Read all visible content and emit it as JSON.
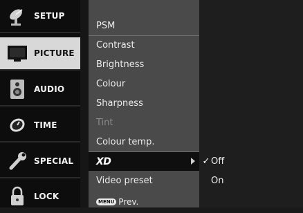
{
  "left_menu": {
    "items": [
      {
        "label": "SETUP",
        "icon": "satellite-dish-icon"
      },
      {
        "label": "PICTURE",
        "icon": "tv-screen-icon"
      },
      {
        "label": "AUDIO",
        "icon": "speaker-icon"
      },
      {
        "label": "TIME",
        "icon": "clock-icon"
      },
      {
        "label": "SPECIAL",
        "icon": "wrench-icon"
      },
      {
        "label": "LOCK",
        "icon": "padlock-icon"
      }
    ],
    "selected": "PICTURE"
  },
  "picture_menu": {
    "items": [
      {
        "label": "PSM"
      },
      {
        "label": "Contrast"
      },
      {
        "label": "Brightness"
      },
      {
        "label": "Colour"
      },
      {
        "label": "Sharpness"
      },
      {
        "label": "Tint",
        "disabled": true
      },
      {
        "label": "Colour temp."
      },
      {
        "label": "XD",
        "selected": true
      },
      {
        "label": "Video preset"
      }
    ]
  },
  "xd_options": {
    "items": [
      {
        "label": "Off",
        "checked": true
      },
      {
        "label": "On",
        "checked": false
      }
    ],
    "check_mark": "✓"
  },
  "footer": {
    "menu_button": "MENU",
    "prev_label": "Prev."
  }
}
